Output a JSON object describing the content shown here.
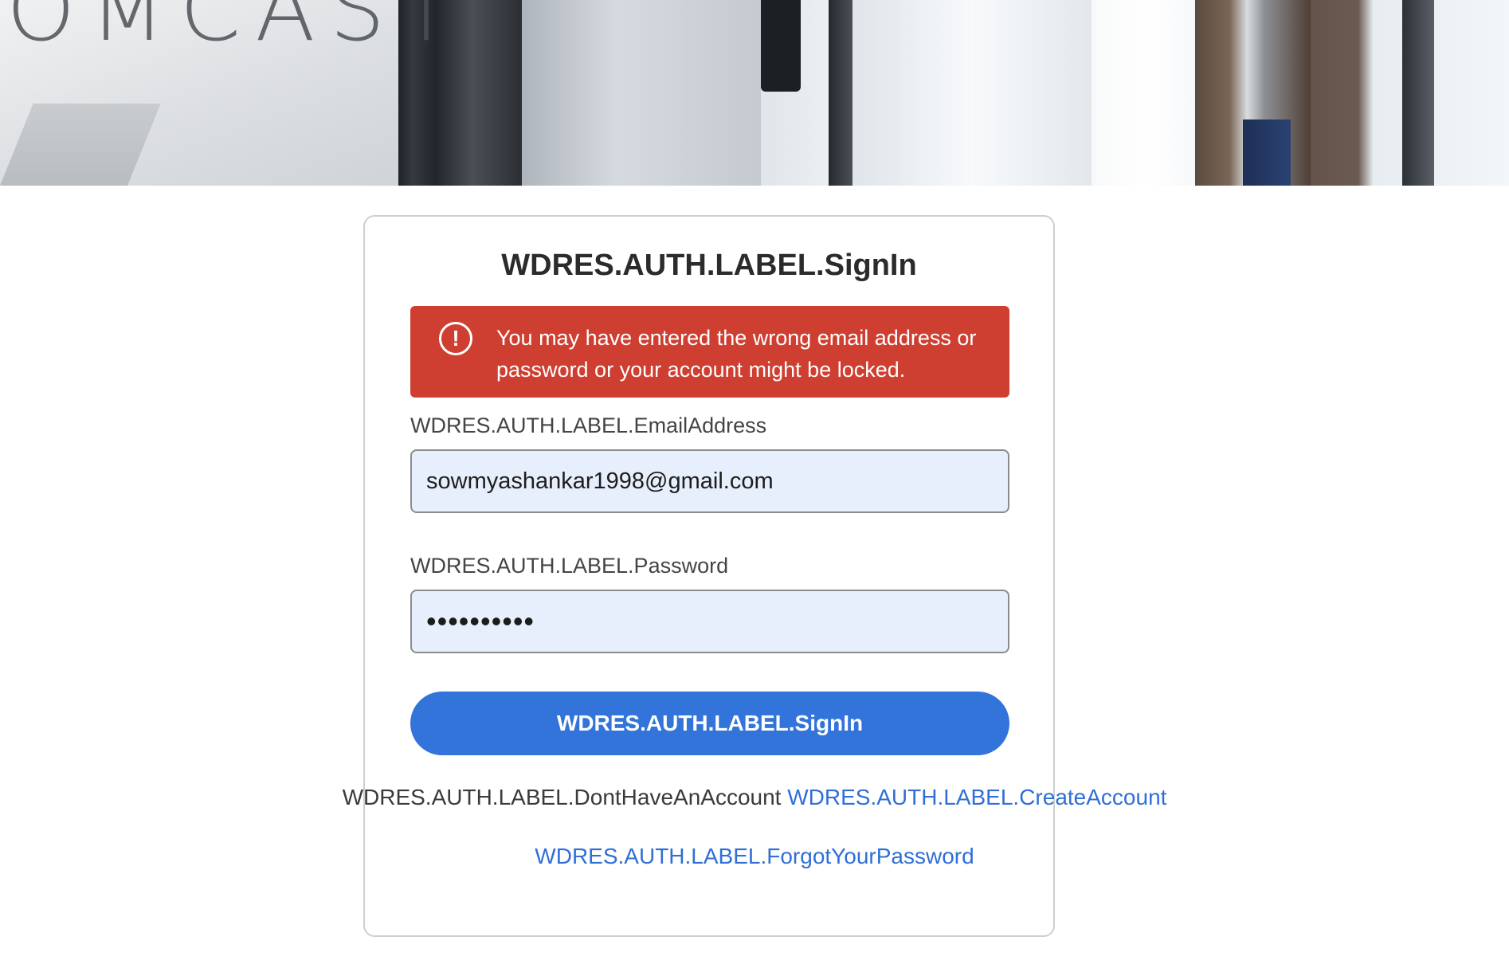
{
  "hero": {
    "logo_text": "OMCAST"
  },
  "signin": {
    "title": "WDRES.AUTH.LABEL.SignIn",
    "error": {
      "icon": "alert-circle-icon",
      "message": "You may have entered the wrong email address or password or your account might be locked."
    },
    "email": {
      "label": "WDRES.AUTH.LABEL.EmailAddress",
      "value": "sowmyashankar1998@gmail.com"
    },
    "password": {
      "label": "WDRES.AUTH.LABEL.Password",
      "value": "••••••••••"
    },
    "button_label": "WDRES.AUTH.LABEL.SignIn",
    "no_account_text": "WDRES.AUTH.LABEL.DontHaveAnAccount",
    "create_account_link": "WDRES.AUTH.LABEL.CreateAccount",
    "forgot_password_link": "WDRES.AUTH.LABEL.ForgotYourPassword"
  },
  "colors": {
    "error_bg": "#cf3f31",
    "primary": "#3274d9",
    "link": "#2f6fd6",
    "input_bg": "#e8effc"
  }
}
